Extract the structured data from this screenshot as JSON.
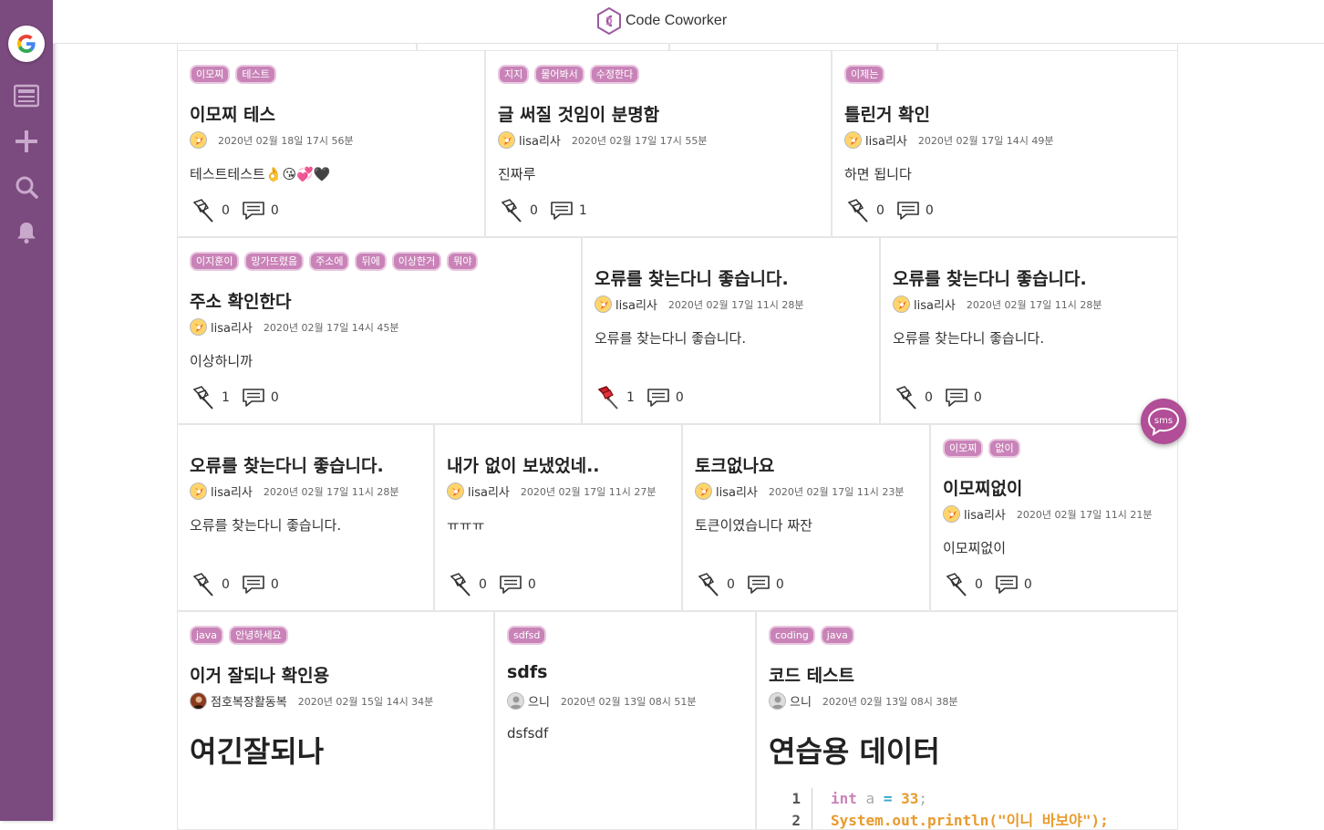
{
  "app": {
    "title": "Code Coworker"
  },
  "sidebar": {
    "google_label": "G"
  },
  "cards": [
    {
      "tags": [
        "이모찌",
        "테스트"
      ],
      "title": "이모찌 테스",
      "author": "",
      "date": "2020년 02월 18일 17시 56분",
      "body": "테스트테스트👌😘💞🖤",
      "pins": "0",
      "comments": "0",
      "pinned": false,
      "avatar": "fox"
    },
    {
      "tags": [
        "지지",
        "물어봐서",
        "수정한다"
      ],
      "title": "글 써질 것임이 분명함",
      "author": "lisa리사",
      "date": "2020년 02월 17일 17시 55분",
      "body": "진짜루",
      "pins": "0",
      "comments": "1",
      "pinned": false,
      "avatar": "fox"
    },
    {
      "tags": [
        "이제는"
      ],
      "title": "틀린거 확인",
      "author": "lisa리사",
      "date": "2020년 02월 17일 14시 49분",
      "body": "하면 됩니다",
      "pins": "0",
      "comments": "0",
      "pinned": false,
      "avatar": "fox"
    },
    {
      "tags": [
        "이지훈이",
        "망가뜨렸음",
        "주소에",
        "뒤에",
        "이상한거",
        "뭐야"
      ],
      "title": "주소 확인한다",
      "author": "lisa리사",
      "date": "2020년 02월 17일 14시 45분",
      "body": "이상하니까",
      "pins": "1",
      "comments": "0",
      "pinned": false,
      "avatar": "fox"
    },
    {
      "tags": [],
      "title": "오류를 찾는다니 좋습니다.",
      "author": "lisa리사",
      "date": "2020년 02월 17일 11시 28분",
      "body": "오류를 찾는다니 좋습니다.",
      "pins": "1",
      "comments": "0",
      "pinned": true,
      "avatar": "fox"
    },
    {
      "tags": [],
      "title": "오류를 찾는다니 좋습니다.",
      "author": "lisa리사",
      "date": "2020년 02월 17일 11시 28분",
      "body": "오류를 찾는다니 좋습니다.",
      "pins": "0",
      "comments": "0",
      "pinned": false,
      "avatar": "fox"
    },
    {
      "tags": [],
      "title": "오류를 찾는다니 좋습니다.",
      "author": "lisa리사",
      "date": "2020년 02월 17일 11시 28분",
      "body": "오류를 찾는다니 좋습니다.",
      "pins": "0",
      "comments": "0",
      "pinned": false,
      "avatar": "fox"
    },
    {
      "tags": [],
      "title": "내가 없이 보냈었네..",
      "author": "lisa리사",
      "date": "2020년 02월 17일 11시 27분",
      "body": "ㅠㅠㅠ",
      "pins": "0",
      "comments": "0",
      "pinned": false,
      "avatar": "fox"
    },
    {
      "tags": [],
      "title": "토크없나요",
      "author": "lisa리사",
      "date": "2020년 02월 17일 11시 23분",
      "body": "토큰이였습니다 짜잔",
      "pins": "0",
      "comments": "0",
      "pinned": false,
      "avatar": "fox"
    },
    {
      "tags": [
        "이모찌",
        "없이"
      ],
      "title": "이모찌없이",
      "author": "lisa리사",
      "date": "2020년 02월 17일 11시 21분",
      "body": "이모찌없이",
      "pins": "0",
      "comments": "0",
      "pinned": false,
      "avatar": "fox"
    },
    {
      "tags": [
        "java",
        "안녕하세요"
      ],
      "title": "이거 잘되나 확인용",
      "author": "점호복장활동복",
      "date": "2020년 02월 15일 14시 34분",
      "body": "여긴잘되나",
      "big": true,
      "avatar": "person"
    },
    {
      "tags": [
        "sdfsd"
      ],
      "title": "sdfs",
      "author": "으니",
      "date": "2020년 02월 13일 08시 51분",
      "body": "dsfsdf",
      "avatar": "default"
    },
    {
      "tags": [
        "coding",
        "java"
      ],
      "title": "코드 테스트",
      "author": "으니",
      "date": "2020년 02월 13일 08시 38분",
      "body": "연습용 데이터",
      "big": true,
      "avatar": "default",
      "code": {
        "line_numbers": [
          "1",
          "2"
        ],
        "line1": {
          "type": "int",
          "var": "a",
          "op": "=",
          "num": "33",
          "end": ";"
        },
        "line2": "System.out.println(\"이니 바보야\");"
      }
    }
  ],
  "fab": {
    "label": "sms"
  }
}
